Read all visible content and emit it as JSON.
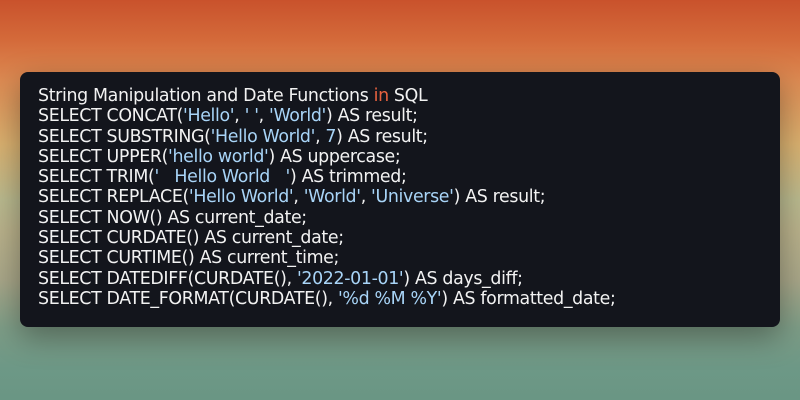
{
  "code": {
    "lines": [
      [
        {
          "t": "String Manipulation and Date Functions ",
          "k": "plain"
        },
        {
          "t": "in",
          "k": "kw"
        },
        {
          "t": " SQL",
          "k": "plain"
        }
      ],
      [
        {
          "t": "SELECT CONCAT(",
          "k": "plain"
        },
        {
          "t": "'Hello'",
          "k": "str"
        },
        {
          "t": ", ",
          "k": "plain"
        },
        {
          "t": "' '",
          "k": "str"
        },
        {
          "t": ", ",
          "k": "plain"
        },
        {
          "t": "'World'",
          "k": "str"
        },
        {
          "t": ") AS result;",
          "k": "plain"
        }
      ],
      [
        {
          "t": "SELECT SUBSTRING(",
          "k": "plain"
        },
        {
          "t": "'Hello World'",
          "k": "str"
        },
        {
          "t": ", ",
          "k": "plain"
        },
        {
          "t": "7",
          "k": "num"
        },
        {
          "t": ") AS result;",
          "k": "plain"
        }
      ],
      [
        {
          "t": "SELECT UPPER(",
          "k": "plain"
        },
        {
          "t": "'hello world'",
          "k": "str"
        },
        {
          "t": ") AS uppercase;",
          "k": "plain"
        }
      ],
      [
        {
          "t": "SELECT TRIM(",
          "k": "plain"
        },
        {
          "t": "'   Hello World   '",
          "k": "str"
        },
        {
          "t": ") AS trimmed;",
          "k": "plain"
        }
      ],
      [
        {
          "t": "SELECT REPLACE(",
          "k": "plain"
        },
        {
          "t": "'Hello World'",
          "k": "str"
        },
        {
          "t": ", ",
          "k": "plain"
        },
        {
          "t": "'World'",
          "k": "str"
        },
        {
          "t": ", ",
          "k": "plain"
        },
        {
          "t": "'Universe'",
          "k": "str"
        },
        {
          "t": ") AS result;",
          "k": "plain"
        }
      ],
      [
        {
          "t": "SELECT NOW() AS current_date;",
          "k": "plain"
        }
      ],
      [
        {
          "t": "SELECT CURDATE() AS current_date;",
          "k": "plain"
        }
      ],
      [
        {
          "t": "SELECT CURTIME() AS current_time;",
          "k": "plain"
        }
      ],
      [
        {
          "t": "SELECT DATEDIFF(CURDATE(), ",
          "k": "plain"
        },
        {
          "t": "'2022-01-01'",
          "k": "str"
        },
        {
          "t": ") AS days_diff;",
          "k": "plain"
        }
      ],
      [
        {
          "t": "SELECT DATE_FORMAT(CURDATE(), ",
          "k": "plain"
        },
        {
          "t": "'%d %M %Y'",
          "k": "str"
        },
        {
          "t": ") AS formatted_date;",
          "k": "plain"
        }
      ]
    ]
  },
  "colors": {
    "panel_background": "#13151c",
    "plain_text": "#f2f2f2",
    "string_literal": "#a8d4f7",
    "keyword": "#e8623f",
    "background_top": "#c9522c",
    "background_middle": "#d9b06f",
    "background_bottom": "#6a9684"
  }
}
